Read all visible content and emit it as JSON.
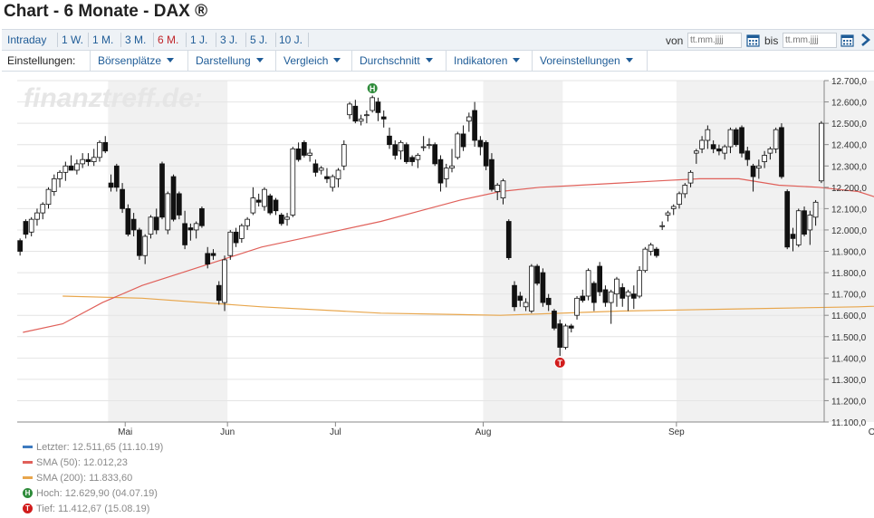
{
  "title": "Chart - 6 Monate - DAX ®",
  "ranges": {
    "items": [
      "Intraday",
      "1 W.",
      "1 M.",
      "3 M.",
      "6 M.",
      "1 J.",
      "3 J.",
      "5 J.",
      "10 J."
    ],
    "active": "6 M."
  },
  "date_filter": {
    "from_label": "von",
    "to_label": "bis",
    "from_placeholder": "tt.mm.jjjj",
    "to_placeholder": "tt.mm.jjjj",
    "calendar_icon": "calendar-icon",
    "go_icon": "chevron-right-icon"
  },
  "settings": {
    "label": "Einstellungen:",
    "menus": [
      "Börsenplätze",
      "Darstellung",
      "Vergleich",
      "Durchschnitt",
      "Indikatoren",
      "Voreinstellungen"
    ]
  },
  "watermark": "finanztreff.de:",
  "colors": {
    "accent": "#1f5c97",
    "active": "#c0262b",
    "sma50": "#e0605a",
    "sma200": "#e8a64c",
    "last": "#3e7bbf",
    "high": "#2e8b3a",
    "low": "#d11c1c"
  },
  "chart_data": {
    "type": "candlestick",
    "x_axis_labels": [
      "Mai",
      "Jun",
      "Jul",
      "Aug",
      "Sep",
      "Okt"
    ],
    "y_ticks": [
      "12.700,0",
      "12.600,0",
      "12.500,0",
      "12.400,0",
      "12.300,0",
      "12.200,0",
      "12.100,0",
      "12.000,0",
      "11.900,0",
      "11.800,0",
      "11.700,0",
      "11.600,0",
      "11.500,0",
      "11.400,0",
      "11.300,0",
      "11.200,0",
      "11.100,0"
    ],
    "ylim": [
      11100,
      12700
    ],
    "candles": [
      [
        11950,
        11960,
        11880,
        11900
      ],
      [
        12040,
        12050,
        11960,
        11980
      ],
      [
        11990,
        12060,
        11970,
        12050
      ],
      [
        12050,
        12100,
        12020,
        12080
      ],
      [
        12080,
        12130,
        12050,
        12120
      ],
      [
        12120,
        12200,
        12100,
        12190
      ],
      [
        12180,
        12260,
        12160,
        12240
      ],
      [
        12240,
        12280,
        12200,
        12270
      ],
      [
        12270,
        12320,
        12230,
        12300
      ],
      [
        12300,
        12350,
        12280,
        12280
      ],
      [
        12280,
        12330,
        12260,
        12310
      ],
      [
        12310,
        12360,
        12290,
        12330
      ],
      [
        12330,
        12360,
        12300,
        12320
      ],
      [
        12320,
        12380,
        12300,
        12340
      ],
      [
        12340,
        12420,
        12320,
        12410
      ],
      [
        12410,
        12440,
        12360,
        12370
      ],
      [
        12220,
        12260,
        12180,
        12200
      ],
      [
        12300,
        12310,
        12180,
        12200
      ],
      [
        12190,
        12220,
        12080,
        12100
      ],
      [
        12100,
        12120,
        11970,
        11980
      ],
      [
        12050,
        12080,
        11970,
        12000
      ],
      [
        12000,
        12010,
        11860,
        11880
      ],
      [
        11880,
        11980,
        11840,
        11970
      ],
      [
        11980,
        12070,
        11960,
        12060
      ],
      [
        12060,
        12100,
        11980,
        12000
      ],
      [
        12310,
        12320,
        12050,
        12060
      ],
      [
        12000,
        12180,
        11980,
        12170
      ],
      [
        12250,
        12260,
        12040,
        12050
      ],
      [
        12170,
        12180,
        12050,
        12070
      ],
      [
        12030,
        12090,
        11910,
        11930
      ],
      [
        12010,
        12030,
        11950,
        12000
      ],
      [
        12000,
        12040,
        11960,
        12030
      ],
      [
        12100,
        12110,
        12010,
        12020
      ],
      [
        11890,
        11920,
        11820,
        11840
      ],
      [
        11890,
        11910,
        11860,
        11880
      ],
      [
        11740,
        11760,
        11650,
        11670
      ],
      [
        11660,
        11880,
        11620,
        11860
      ],
      [
        11880,
        12000,
        11860,
        11990
      ],
      [
        11990,
        12010,
        11920,
        11940
      ],
      [
        11960,
        12030,
        11940,
        12020
      ],
      [
        12020,
        12060,
        12000,
        12050
      ],
      [
        12080,
        12200,
        12070,
        12150
      ],
      [
        12140,
        12170,
        12110,
        12130
      ],
      [
        12110,
        12200,
        12090,
        12190
      ],
      [
        12160,
        12170,
        12070,
        12080
      ],
      [
        12140,
        12150,
        12070,
        12090
      ],
      [
        12070,
        12080,
        12020,
        12030
      ],
      [
        12050,
        12080,
        12020,
        12060
      ],
      [
        12070,
        12390,
        12060,
        12380
      ],
      [
        12380,
        12410,
        12320,
        12330
      ],
      [
        12410,
        12420,
        12340,
        12350
      ],
      [
        12350,
        12380,
        12320,
        12360
      ],
      [
        12310,
        12330,
        12250,
        12270
      ],
      [
        12280,
        12300,
        12260,
        12290
      ],
      [
        12250,
        12290,
        12220,
        12240
      ],
      [
        12200,
        12260,
        12180,
        12250
      ],
      [
        12240,
        12290,
        12200,
        12280
      ],
      [
        12300,
        12420,
        12280,
        12400
      ],
      [
        12540,
        12600,
        12520,
        12590
      ],
      [
        12580,
        12610,
        12500,
        12510
      ],
      [
        12510,
        12540,
        12490,
        12520
      ],
      [
        12540,
        12560,
        12500,
        12540
      ],
      [
        12560,
        12630,
        12550,
        12620
      ],
      [
        12600,
        12620,
        12510,
        12550
      ],
      [
        12530,
        12560,
        12480,
        12520
      ],
      [
        12440,
        12480,
        12380,
        12400
      ],
      [
        12400,
        12420,
        12330,
        12350
      ],
      [
        12370,
        12420,
        12330,
        12410
      ],
      [
        12400,
        12410,
        12310,
        12320
      ],
      [
        12340,
        12350,
        12300,
        12320
      ],
      [
        12330,
        12360,
        12290,
        12350
      ],
      [
        12390,
        12440,
        12370,
        12390
      ],
      [
        12400,
        12430,
        12380,
        12400
      ],
      [
        12400,
        12410,
        12300,
        12310
      ],
      [
        12330,
        12350,
        12180,
        12220
      ],
      [
        12240,
        12310,
        12200,
        12290
      ],
      [
        12290,
        12380,
        12270,
        12300
      ],
      [
        12340,
        12460,
        12330,
        12450
      ],
      [
        12450,
        12490,
        12370,
        12390
      ],
      [
        12510,
        12550,
        12460,
        12530
      ],
      [
        12560,
        12600,
        12390,
        12420
      ],
      [
        12420,
        12440,
        12350,
        12390
      ],
      [
        12410,
        12420,
        12280,
        12300
      ],
      [
        12330,
        12360,
        12180,
        12190
      ],
      [
        12180,
        12220,
        12140,
        12210
      ],
      [
        12150,
        12240,
        12120,
        12230
      ],
      [
        12040,
        12050,
        11860,
        11870
      ],
      [
        11740,
        11760,
        11620,
        11640
      ],
      [
        11690,
        11710,
        11640,
        11670
      ],
      [
        11640,
        11680,
        11620,
        11660
      ],
      [
        11620,
        11840,
        11610,
        11830
      ],
      [
        11830,
        11840,
        11740,
        11750
      ],
      [
        11800,
        11820,
        11640,
        11660
      ],
      [
        11680,
        11700,
        11620,
        11650
      ],
      [
        11620,
        11630,
        11530,
        11540
      ],
      [
        11560,
        11580,
        11410,
        11450
      ],
      [
        11450,
        11560,
        11440,
        11550
      ],
      [
        11550,
        11560,
        11520,
        11540
      ],
      [
        11600,
        11690,
        11580,
        11680
      ],
      [
        11690,
        11720,
        11660,
        11670
      ],
      [
        11690,
        11820,
        11670,
        11810
      ],
      [
        11750,
        11760,
        11620,
        11660
      ],
      [
        11830,
        11850,
        11690,
        11710
      ],
      [
        11720,
        11740,
        11640,
        11660
      ],
      [
        11660,
        11720,
        11560,
        11710
      ],
      [
        11700,
        11780,
        11640,
        11770
      ],
      [
        11730,
        11750,
        11640,
        11680
      ],
      [
        11690,
        11720,
        11620,
        11710
      ],
      [
        11700,
        11740,
        11630,
        11680
      ],
      [
        11690,
        11830,
        11680,
        11810
      ],
      [
        11810,
        11920,
        11800,
        11910
      ],
      [
        11900,
        11940,
        11880,
        11930
      ],
      [
        11910,
        11920,
        11870,
        11880
      ],
      [
        12020,
        12040,
        12000,
        12020
      ],
      [
        12070,
        12090,
        12040,
        12080
      ],
      [
        12100,
        12120,
        12070,
        12110
      ],
      [
        12120,
        12180,
        12100,
        12170
      ],
      [
        12170,
        12220,
        12150,
        12210
      ],
      [
        12220,
        12280,
        12200,
        12270
      ],
      [
        12360,
        12380,
        12310,
        12370
      ],
      [
        12380,
        12440,
        12360,
        12420
      ],
      [
        12420,
        12490,
        12380,
        12470
      ],
      [
        12400,
        12420,
        12360,
        12380
      ],
      [
        12380,
        12400,
        12350,
        12370
      ],
      [
        12360,
        12400,
        12330,
        12390
      ],
      [
        12390,
        12480,
        12360,
        12470
      ],
      [
        12470,
        12480,
        12390,
        12400
      ],
      [
        12480,
        12490,
        12340,
        12360
      ],
      [
        12370,
        12390,
        12300,
        12330
      ],
      [
        12300,
        12310,
        12180,
        12250
      ],
      [
        12290,
        12330,
        12240,
        12300
      ],
      [
        12320,
        12370,
        12290,
        12350
      ],
      [
        12360,
        12390,
        12330,
        12380
      ],
      [
        12380,
        12480,
        12360,
        12470
      ],
      [
        12480,
        12500,
        12240,
        12250
      ],
      [
        12180,
        12190,
        11910,
        11920
      ],
      [
        11980,
        12010,
        11900,
        11960
      ],
      [
        11930,
        12100,
        11920,
        12090
      ],
      [
        12090,
        12110,
        11970,
        11980
      ],
      [
        12000,
        12090,
        11930,
        12070
      ],
      [
        12060,
        12140,
        12020,
        12130
      ],
      [
        12230,
        12510,
        12220,
        12500
      ]
    ],
    "sma50": [
      [
        1,
        11520
      ],
      [
        8,
        11560
      ],
      [
        15,
        11660
      ],
      [
        22,
        11740
      ],
      [
        29,
        11800
      ],
      [
        36,
        11860
      ],
      [
        43,
        11920
      ],
      [
        50,
        11960
      ],
      [
        57,
        12000
      ],
      [
        64,
        12040
      ],
      [
        71,
        12090
      ],
      [
        78,
        12140
      ],
      [
        85,
        12180
      ],
      [
        92,
        12200
      ],
      [
        99,
        12210
      ],
      [
        106,
        12220
      ],
      [
        113,
        12230
      ],
      [
        120,
        12240
      ],
      [
        127,
        12240
      ],
      [
        134,
        12210
      ],
      [
        141,
        12200
      ],
      [
        148,
        12180
      ],
      [
        155,
        12120
      ],
      [
        162,
        12060
      ],
      [
        169,
        12040
      ],
      [
        176,
        12030
      ],
      [
        183,
        12020
      ],
      [
        190,
        12010
      ],
      [
        197,
        12010
      ]
    ],
    "sma200": [
      [
        8,
        11690
      ],
      [
        22,
        11680
      ],
      [
        43,
        11640
      ],
      [
        64,
        11610
      ],
      [
        85,
        11600
      ],
      [
        106,
        11620
      ],
      [
        127,
        11630
      ],
      [
        148,
        11640
      ],
      [
        169,
        11660
      ],
      [
        190,
        11700
      ],
      [
        211,
        11770
      ],
      [
        232,
        11830
      ],
      [
        253,
        11870
      ]
    ],
    "highlight_bands": [
      [
        16,
        37
      ],
      [
        82,
        96
      ],
      [
        116,
        151
      ]
    ],
    "x_label_positions": [
      19,
      37,
      56,
      82,
      116,
      151
    ],
    "markers": [
      {
        "label": "H",
        "value": 12629.9
      },
      {
        "label": "T",
        "value": 11412.67
      }
    ],
    "legend": [
      {
        "key": "last",
        "text": "Letzter: 12.511,65 (11.10.19)"
      },
      {
        "key": "sma50",
        "text": "SMA (50): 12.012,23"
      },
      {
        "key": "sma200",
        "text": "SMA (200): 11.833,60"
      },
      {
        "key": "high",
        "text": "Hoch: 12.629,90 (04.07.19)"
      },
      {
        "key": "low",
        "text": "Tief: 11.412,67 (15.08.19)"
      }
    ]
  }
}
